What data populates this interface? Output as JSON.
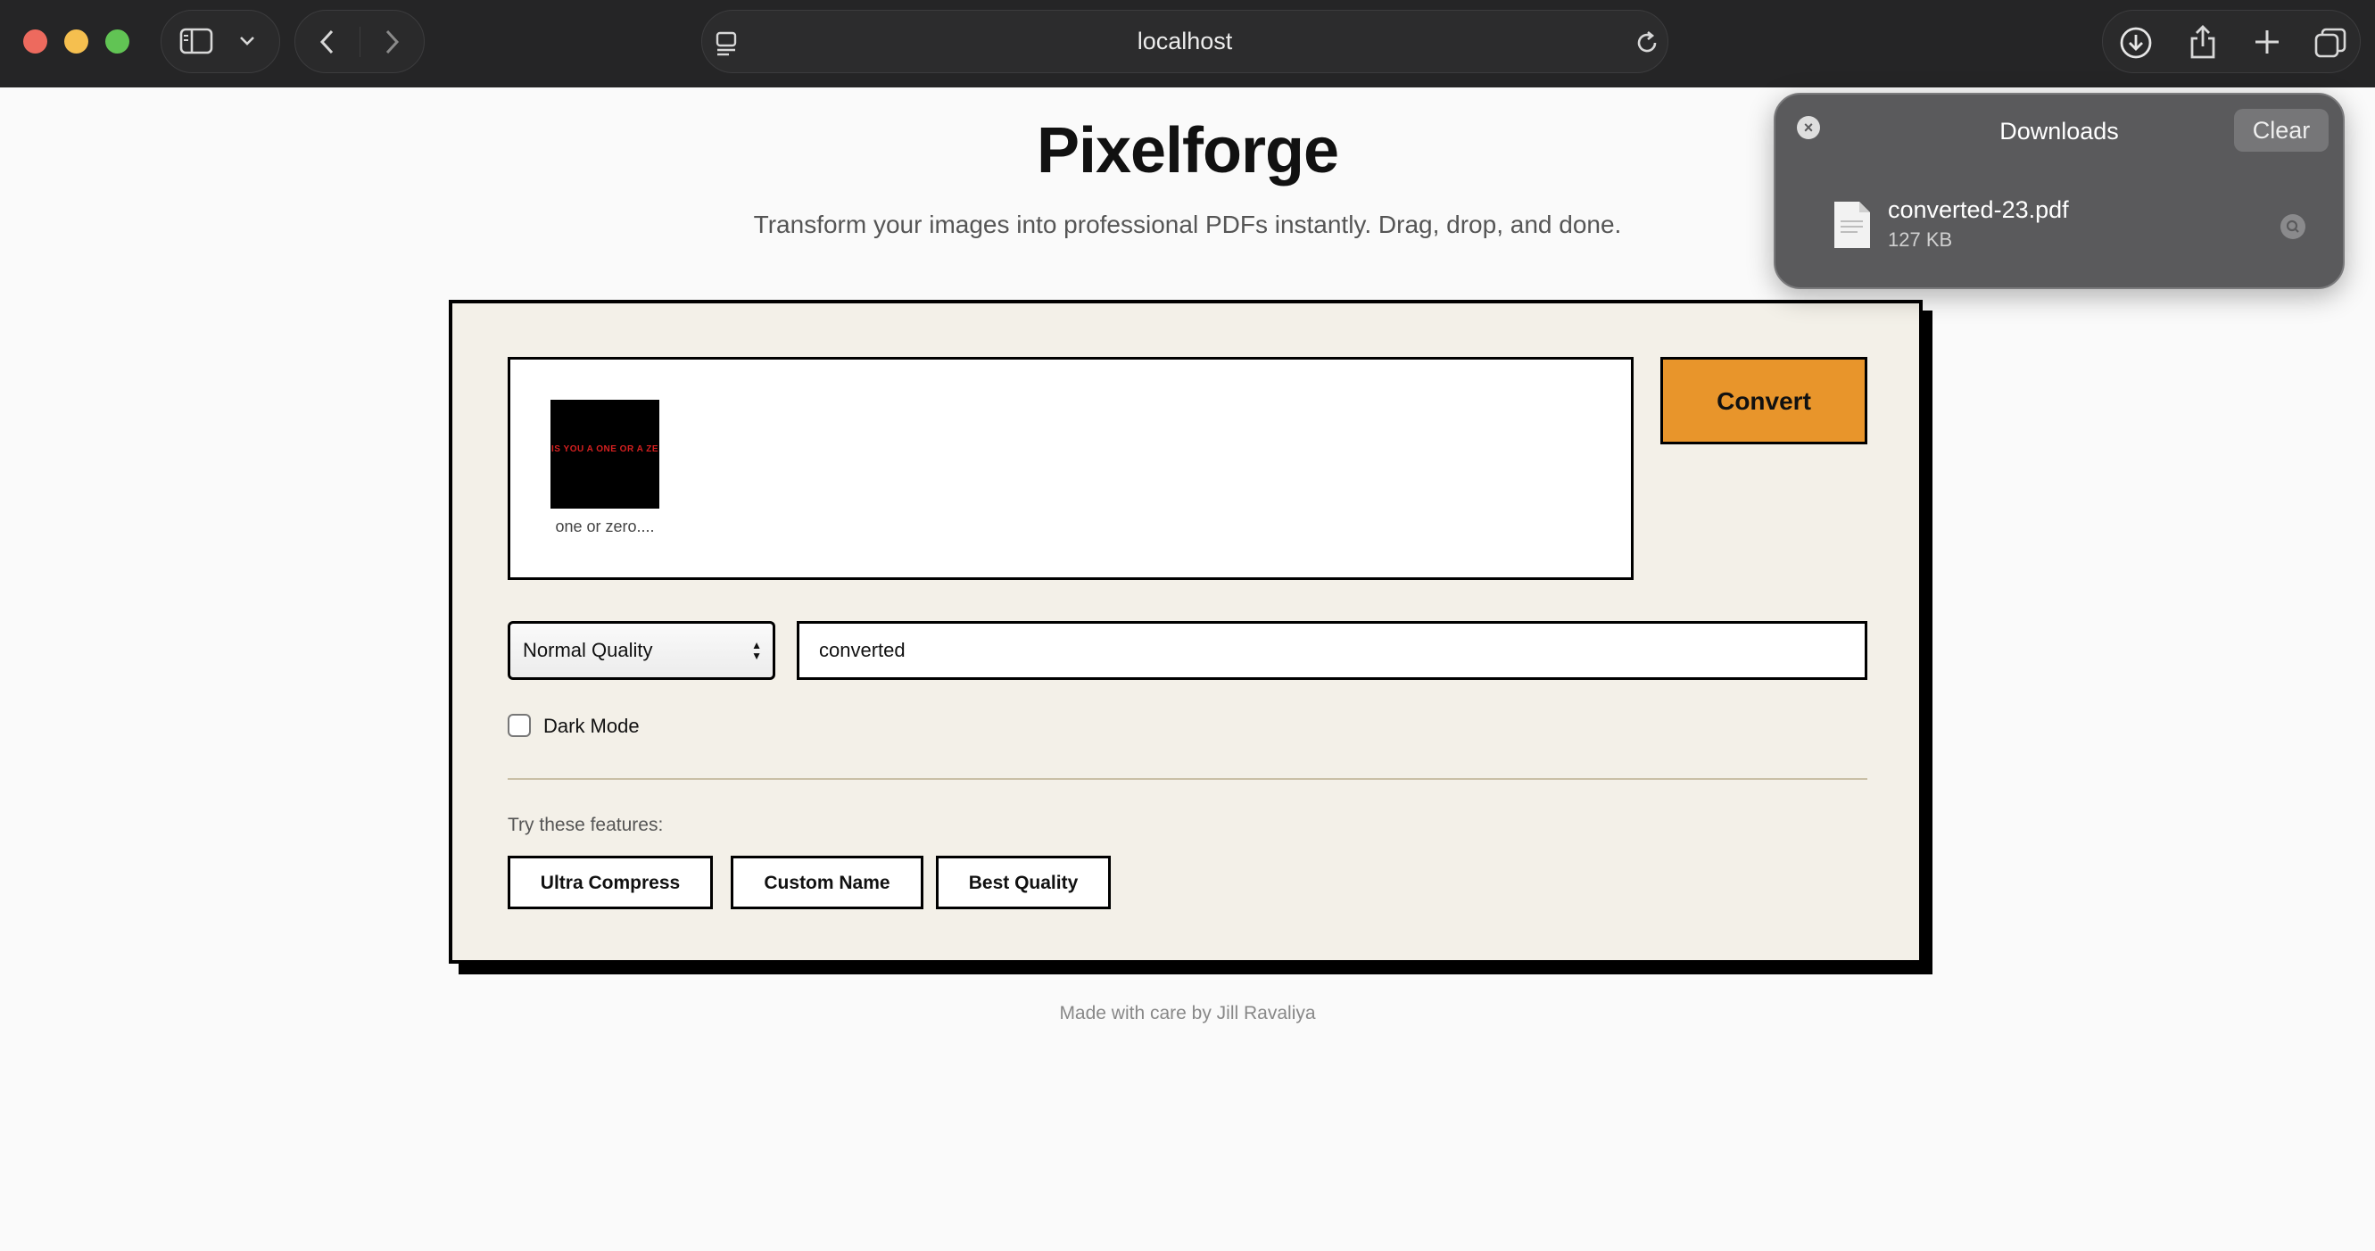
{
  "browser": {
    "address": "localhost"
  },
  "page": {
    "title": "Pixelforge",
    "subtitle": "Transform your images into professional PDFs instantly. Drag, drop, and done."
  },
  "converter": {
    "thumbnail_text": "IS YOU A ONE OR A ZE",
    "thumbnail_caption": "one or zero....",
    "convert_label": "Convert",
    "quality_value": "Normal Quality",
    "filename_value": "converted",
    "dark_mode_label": "Dark Mode",
    "dark_mode_checked": false,
    "features_label": "Try these features:",
    "features": [
      "Ultra Compress",
      "Custom Name",
      "Best Quality"
    ]
  },
  "footer": {
    "text": "Made with care by Jill Ravaliya"
  },
  "downloads": {
    "title": "Downloads",
    "clear_label": "Clear",
    "file_name": "converted-23.pdf",
    "file_size": "127 KB"
  },
  "colors": {
    "accent": "#e8952b",
    "card_bg": "#f3f0e8",
    "chrome_bg": "#252526"
  }
}
